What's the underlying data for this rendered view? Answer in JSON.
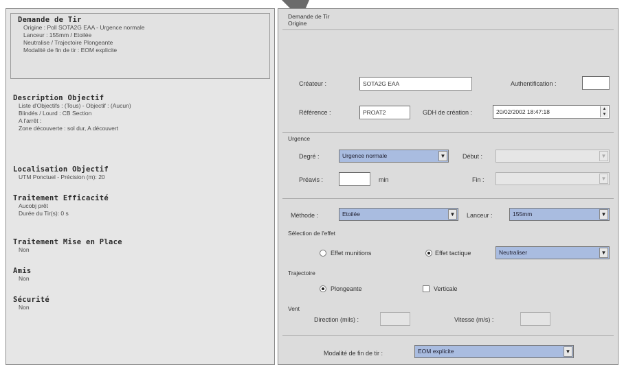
{
  "summary": {
    "sections": [
      {
        "title": "Demande de Tir",
        "lines": [
          "Origine : Poll SOTA2G EAA - Urgence normale",
          "Lanceur : 155mm / Etoilée",
          "Neutralise / Trajectoire Plongeante",
          "Modalité de fin de tir : EOM explicite"
        ]
      },
      {
        "title": "Description Objectif",
        "lines": [
          "Liste d'Objectifs : (Tous) - Objectif : (Aucun)",
          "Blindés / Lourd : CB Section",
          "A l'arrêt :",
          "Zone découverte : sol dur, A découvert"
        ]
      },
      {
        "title": "Localisation Objectif",
        "lines": [
          "UTM Ponctuel - Précision (m): 20"
        ]
      },
      {
        "title": "Traitement Efficacité",
        "lines": [
          "Aucobj prêt",
          "Durée du Tir(s): 0 s"
        ]
      },
      {
        "title": "Traitement Mise en Place",
        "lines": [
          "Non"
        ]
      },
      {
        "title": "Amis",
        "lines": [
          "Non"
        ]
      },
      {
        "title": "Sécurité",
        "lines": [
          "Non"
        ]
      }
    ]
  },
  "form": {
    "header_title": "Demande de Tir",
    "header_sub": "Origine",
    "createur_label": "Créateur :",
    "createur_value": "SOTA2G EAA",
    "authentification_label": "Authentification :",
    "authentification_value": "",
    "reference_label": "Référence :",
    "reference_value": "PROAT2",
    "gdh_label": "GDH de création :",
    "gdh_value": "20/02/2002 18:47:18",
    "urgence_group": "Urgence",
    "degre_label": "Degré :",
    "degre_value": "Urgence normale",
    "debut_label": "Début :",
    "debut_value": "",
    "preavis_label": "Préavis :",
    "preavis_value": "",
    "preavis_unit": "min",
    "fin_label": "Fin :",
    "fin_value": "",
    "munition_label": "Méthode :",
    "munition_value": "Etoilée",
    "lanceur_label": "Lanceur :",
    "lanceur_value": "155mm",
    "effet_group": "Sélection de l'effet",
    "effet_option1": "Effet munitions",
    "effet_option2": "Effet tactique",
    "effet_value": "Neutraliser",
    "trajectoire_group": "Trajectoire",
    "traj_option1": "Plongeante",
    "traj_option2": "Verticale",
    "vent_group": "Vent",
    "direction_label": "Direction (mils) :",
    "direction_value": "",
    "vitesse_label": "Vitesse (m/s) :",
    "vitesse_value": "",
    "modalite_label": "Modalité de fin de tir :",
    "modalite_value": "EOM explicite"
  },
  "colors": {
    "select_accent": "#a9bce0",
    "panel_bg": "#dcdcdc",
    "arrow": "#6b6b6b"
  },
  "icons": [
    "arrow-icon",
    "dropdown-arrow-icon",
    "spin-arrows-icon"
  ]
}
